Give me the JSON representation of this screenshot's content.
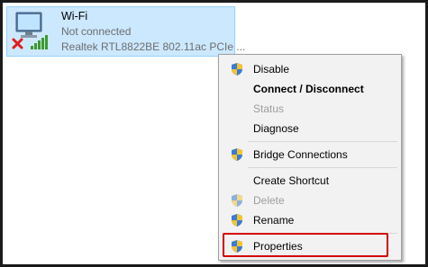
{
  "adapter": {
    "name": "Wi-Fi",
    "status": "Not connected",
    "device": "Realtek RTL8822BE 802.11ac PCIe ..."
  },
  "menu": {
    "items": [
      {
        "label": "Disable",
        "shield": true,
        "bold": false,
        "disabled": false
      },
      {
        "label": "Connect / Disconnect",
        "shield": false,
        "bold": true,
        "disabled": false
      },
      {
        "label": "Status",
        "shield": false,
        "bold": false,
        "disabled": true
      },
      {
        "label": "Diagnose",
        "shield": false,
        "bold": false,
        "disabled": false
      },
      {
        "label": "Bridge Connections",
        "shield": true,
        "bold": false,
        "disabled": false
      },
      {
        "label": "Create Shortcut",
        "shield": false,
        "bold": false,
        "disabled": false
      },
      {
        "label": "Delete",
        "shield": true,
        "bold": false,
        "disabled": true
      },
      {
        "label": "Rename",
        "shield": true,
        "bold": false,
        "disabled": false
      },
      {
        "label": "Properties",
        "shield": true,
        "bold": false,
        "disabled": false
      }
    ]
  },
  "colors": {
    "selection_bg": "#cce8ff",
    "highlight_box": "#d40000",
    "signal_bars": "#3c9a2a",
    "error_x": "#e21c1c"
  }
}
